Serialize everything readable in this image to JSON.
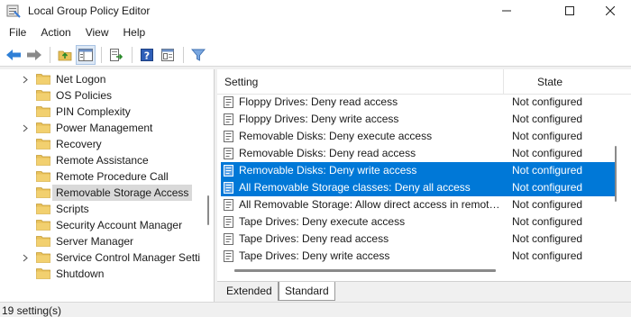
{
  "window": {
    "title": "Local Group Policy Editor"
  },
  "menu": [
    "File",
    "Action",
    "View",
    "Help"
  ],
  "toolbar": {
    "icons": [
      "back-arrow-icon",
      "forward-arrow-icon",
      "up-folder-icon",
      "show-hide-tree-icon",
      "export-list-icon",
      "help-icon",
      "properties-icon",
      "filter-icon"
    ]
  },
  "tree": {
    "items": [
      {
        "label": "Net Logon",
        "expandable": true,
        "selected": false
      },
      {
        "label": "OS Policies",
        "expandable": false,
        "selected": false
      },
      {
        "label": "PIN Complexity",
        "expandable": false,
        "selected": false
      },
      {
        "label": "Power Management",
        "expandable": true,
        "selected": false
      },
      {
        "label": "Recovery",
        "expandable": false,
        "selected": false
      },
      {
        "label": "Remote Assistance",
        "expandable": false,
        "selected": false
      },
      {
        "label": "Remote Procedure Call",
        "expandable": false,
        "selected": false
      },
      {
        "label": "Removable Storage Access",
        "expandable": false,
        "selected": true
      },
      {
        "label": "Scripts",
        "expandable": false,
        "selected": false
      },
      {
        "label": "Security Account Manager",
        "expandable": false,
        "selected": false
      },
      {
        "label": "Server Manager",
        "expandable": false,
        "selected": false
      },
      {
        "label": "Service Control Manager Setti",
        "expandable": true,
        "selected": false
      },
      {
        "label": "Shutdown",
        "expandable": false,
        "selected": false
      }
    ]
  },
  "list": {
    "columns": {
      "setting": "Setting",
      "state": "State"
    },
    "rows": [
      {
        "name": "Floppy Drives: Deny read access",
        "state": "Not configured",
        "selected": false
      },
      {
        "name": "Floppy Drives: Deny write access",
        "state": "Not configured",
        "selected": false
      },
      {
        "name": "Removable Disks: Deny execute access",
        "state": "Not configured",
        "selected": false
      },
      {
        "name": "Removable Disks: Deny read access",
        "state": "Not configured",
        "selected": false
      },
      {
        "name": "Removable Disks: Deny write access",
        "state": "Not configured",
        "selected": true
      },
      {
        "name": "All Removable Storage classes: Deny all access",
        "state": "Not configured",
        "selected": true
      },
      {
        "name": "All Removable Storage: Allow direct access in remote ...",
        "state": "Not configured",
        "selected": false
      },
      {
        "name": "Tape Drives: Deny execute access",
        "state": "Not configured",
        "selected": false
      },
      {
        "name": "Tape Drives: Deny read access",
        "state": "Not configured",
        "selected": false
      },
      {
        "name": "Tape Drives: Deny write access",
        "state": "Not configured",
        "selected": false
      }
    ]
  },
  "tabs": {
    "extended": "Extended",
    "standard": "Standard",
    "active": "Standard"
  },
  "status": {
    "text": "19 setting(s)"
  },
  "colors": {
    "selection": "#0078d7",
    "tree_selection": "#d9d9d9",
    "folder": "#e8c15a"
  }
}
